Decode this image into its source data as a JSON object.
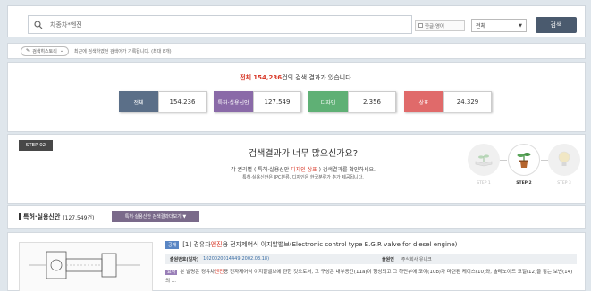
{
  "search": {
    "query": "차종차*엔진",
    "option_label": "한글·영어",
    "select_value": "전체",
    "button_label": "검색"
  },
  "history": {
    "chip_label": "검색히스토리",
    "text": "최근에 검색하였던 검색어가 기록됩니다. (최대 8개)"
  },
  "results": {
    "prefix": "전체",
    "total": "154,236",
    "suffix": "건의 검색 결과가 있습니다.",
    "stats": [
      {
        "label": "전체",
        "value": "154,236",
        "color": "#5b6f88"
      },
      {
        "label": "특허·실용신안",
        "value": "127,549",
        "color": "#8a6aa8"
      },
      {
        "label": "디자인",
        "value": "2,356",
        "color": "#5fb075"
      },
      {
        "label": "상표",
        "value": "24,329",
        "color": "#e06a6a"
      }
    ]
  },
  "notice": {
    "step_tag": "STEP 02",
    "title": "검색결과가 너무 많으신가요?",
    "line1_a": "각 권리별 ( 특허·실용신안",
    "line1_hl": "디자인 상표",
    "line1_b": ") 검색결과를 확인하세요.",
    "line2": "특허·실용신안은 IPC분류, 디자인은 한국분류가 추가 제공됩니다.",
    "steps": [
      {
        "label": "STEP 1",
        "icon": "book-plant-icon"
      },
      {
        "label": "STEP 2",
        "icon": "potted-plant-icon"
      },
      {
        "label": "STEP 3",
        "icon": "light-bulb-icon"
      }
    ]
  },
  "section": {
    "title": "특허·실용신안",
    "count": "(127,549건)",
    "button_label": "특허·실용신안 검색결과더보기 ▼"
  },
  "item": {
    "kind": "공개",
    "index": "[1]",
    "title_a": "경유차",
    "title_hl": "엔진",
    "title_b": "용 전자제어식 이지알밸브(Electronic control type E.G.R valve for diesel engine)",
    "app_no_label": "출원번호(일자)",
    "app_no_value": "1020020014449(2002.03.18)",
    "applicant_label": "출원인",
    "applicant_value": "주식회사 유니크",
    "abstract_badge": "요약",
    "abstract_a": "본 발명은 경유차",
    "abstract_hl": "엔진",
    "abstract_b": "용 전자제어식 이지알밸브에 관한 것으로서, 그 구성은 내부공간(11a)이 형성되고 그 하단부에 코어(10b)가 마련된 케이스(10)와, 솔레노이드 코일(12)을 감는 보빈(14)의 ..."
  }
}
